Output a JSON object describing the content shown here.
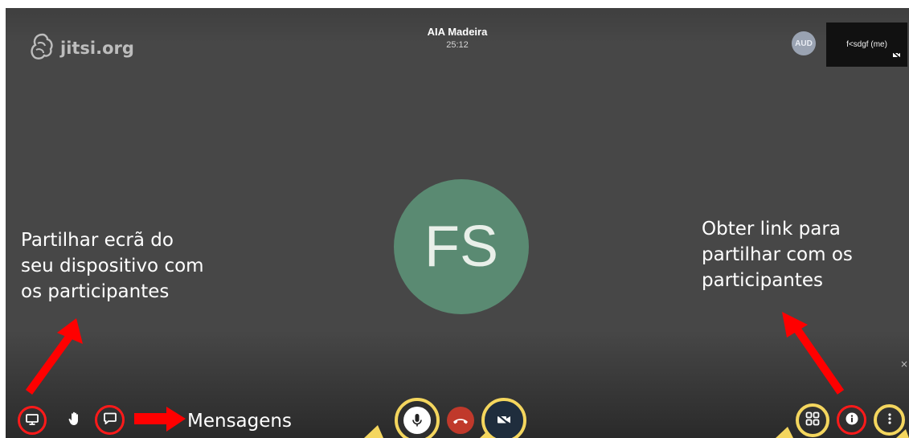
{
  "brand": {
    "logo_text": "jitsi.org",
    "icon": "jitsi-logo-icon"
  },
  "meeting": {
    "title": "AIA Madeira",
    "duration": "25:12"
  },
  "participants": {
    "remote_badge": "AUD",
    "local_name": "f<sdgf (me)",
    "dominant_initials": "FS"
  },
  "annotations": {
    "share_screen": "Partilhar ecrã do\nseu dispositivo com\nos participantes",
    "invite_link": "Obter link para\npartilhar com os\nparticipantes",
    "messages": "Mensagens"
  },
  "toolbar": {
    "left": [
      {
        "name": "screenshare",
        "icon": "monitor-icon"
      },
      {
        "name": "raise-hand",
        "icon": "hand-icon"
      },
      {
        "name": "chat",
        "icon": "chat-bubble-icon"
      }
    ],
    "center": [
      {
        "name": "microphone",
        "icon": "microphone-icon"
      },
      {
        "name": "hangup",
        "icon": "phone-hangup-icon"
      },
      {
        "name": "camera",
        "icon": "camera-off-icon"
      }
    ],
    "right": [
      {
        "name": "tile-view",
        "icon": "grid-icon"
      },
      {
        "name": "info",
        "icon": "info-icon"
      },
      {
        "name": "more",
        "icon": "more-vertical-icon"
      }
    ]
  },
  "colors": {
    "background": "#474747",
    "avatar": "#5a8a72",
    "highlight_red": "#ff1a1a",
    "highlight_yellow": "#f4d65e",
    "hangup": "#c0392b",
    "annotation_arrow": "#ff0000"
  }
}
